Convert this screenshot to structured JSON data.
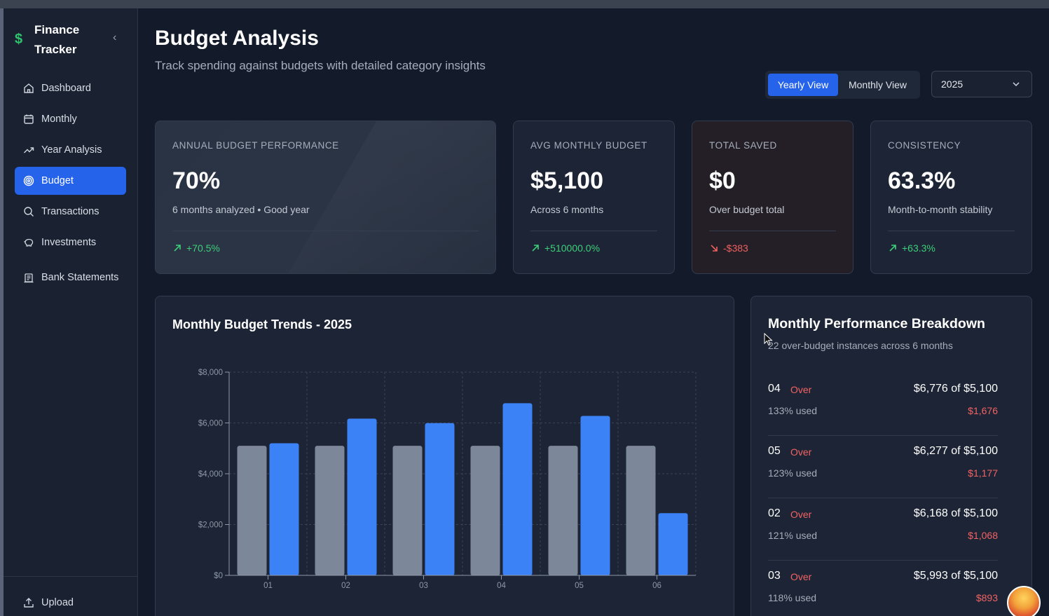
{
  "app": {
    "name": "Finance Tracker",
    "logo_icon": "dollar-icon",
    "logo_glyph": "$"
  },
  "sidebar": {
    "items": [
      {
        "label": "Dashboard",
        "icon": "home-icon",
        "active": false
      },
      {
        "label": "Monthly",
        "icon": "calendar-icon",
        "active": false
      },
      {
        "label": "Year Analysis",
        "icon": "trending-up-icon",
        "active": false
      },
      {
        "label": "Budget",
        "icon": "target-icon",
        "active": true
      },
      {
        "label": "Transactions",
        "icon": "search-icon",
        "active": false
      },
      {
        "label": "Investments",
        "icon": "piggy-bank-icon",
        "active": false
      },
      {
        "label": "Bank Statements",
        "icon": "bank-icon",
        "active": false
      }
    ],
    "footer": {
      "label": "Upload",
      "icon": "upload-icon"
    }
  },
  "header": {
    "title": "Budget Analysis",
    "subtitle": "Track spending against budgets with detailed category insights",
    "view_toggle": {
      "yearly": "Yearly View",
      "monthly": "Monthly View",
      "selected": "Yearly View"
    },
    "year_select": {
      "value": "2025"
    }
  },
  "stats": {
    "annual": {
      "label": "Annual Budget Performance",
      "value": "70%",
      "sub": "6 months analyzed • Good year",
      "trend": "+70.5%",
      "trend_dir": "up"
    },
    "avg": {
      "label": "Avg Monthly Budget",
      "value": "$5,100",
      "sub": "Across 6 months",
      "trend": "+510000.0%",
      "trend_dir": "up"
    },
    "saved": {
      "label": "Total Saved",
      "value": "$0",
      "sub": "Over budget total",
      "trend": "-$383",
      "trend_dir": "down"
    },
    "consistency": {
      "label": "Consistency",
      "value": "63.3%",
      "sub": "Month-to-month stability",
      "trend": "+63.3%",
      "trend_dir": "up"
    }
  },
  "chart": {
    "title": "Monthly Budget Trends - 2025"
  },
  "chart_data": {
    "type": "bar",
    "categories": [
      "01",
      "02",
      "03",
      "04",
      "05",
      "06"
    ],
    "series": [
      {
        "values": [
          5100,
          5100,
          5100,
          5100,
          5100,
          5100
        ],
        "color": "#7c8799"
      },
      {
        "values": [
          5200,
          6168,
          5993,
          6776,
          6277,
          2450
        ],
        "color": "#3b82f6"
      }
    ],
    "ylim": [
      0,
      8000
    ],
    "yticks": [
      "$0",
      "$2,000",
      "$4,000",
      "$6,000",
      "$8,000"
    ],
    "grid": true
  },
  "performance": {
    "title": "Monthly Performance Breakdown",
    "subtitle": "22 over-budget instances across 6 months",
    "rows": [
      {
        "month": "04",
        "status": "Over",
        "amount": "$6,776 of $5,100",
        "pct": "133% used",
        "diff": "$1,676"
      },
      {
        "month": "05",
        "status": "Over",
        "amount": "$6,277 of $5,100",
        "pct": "123% used",
        "diff": "$1,177"
      },
      {
        "month": "02",
        "status": "Over",
        "amount": "$6,168 of $5,100",
        "pct": "121% used",
        "diff": "$1,068"
      },
      {
        "month": "03",
        "status": "Over",
        "amount": "$5,993 of $5,100",
        "pct": "118% used",
        "diff": "$893"
      }
    ]
  },
  "colors": {
    "accent": "#2563eb",
    "positive": "#3ecf7a",
    "negative": "#f0605f",
    "bar_budget": "#7c8799",
    "bar_actual": "#3b82f6"
  }
}
